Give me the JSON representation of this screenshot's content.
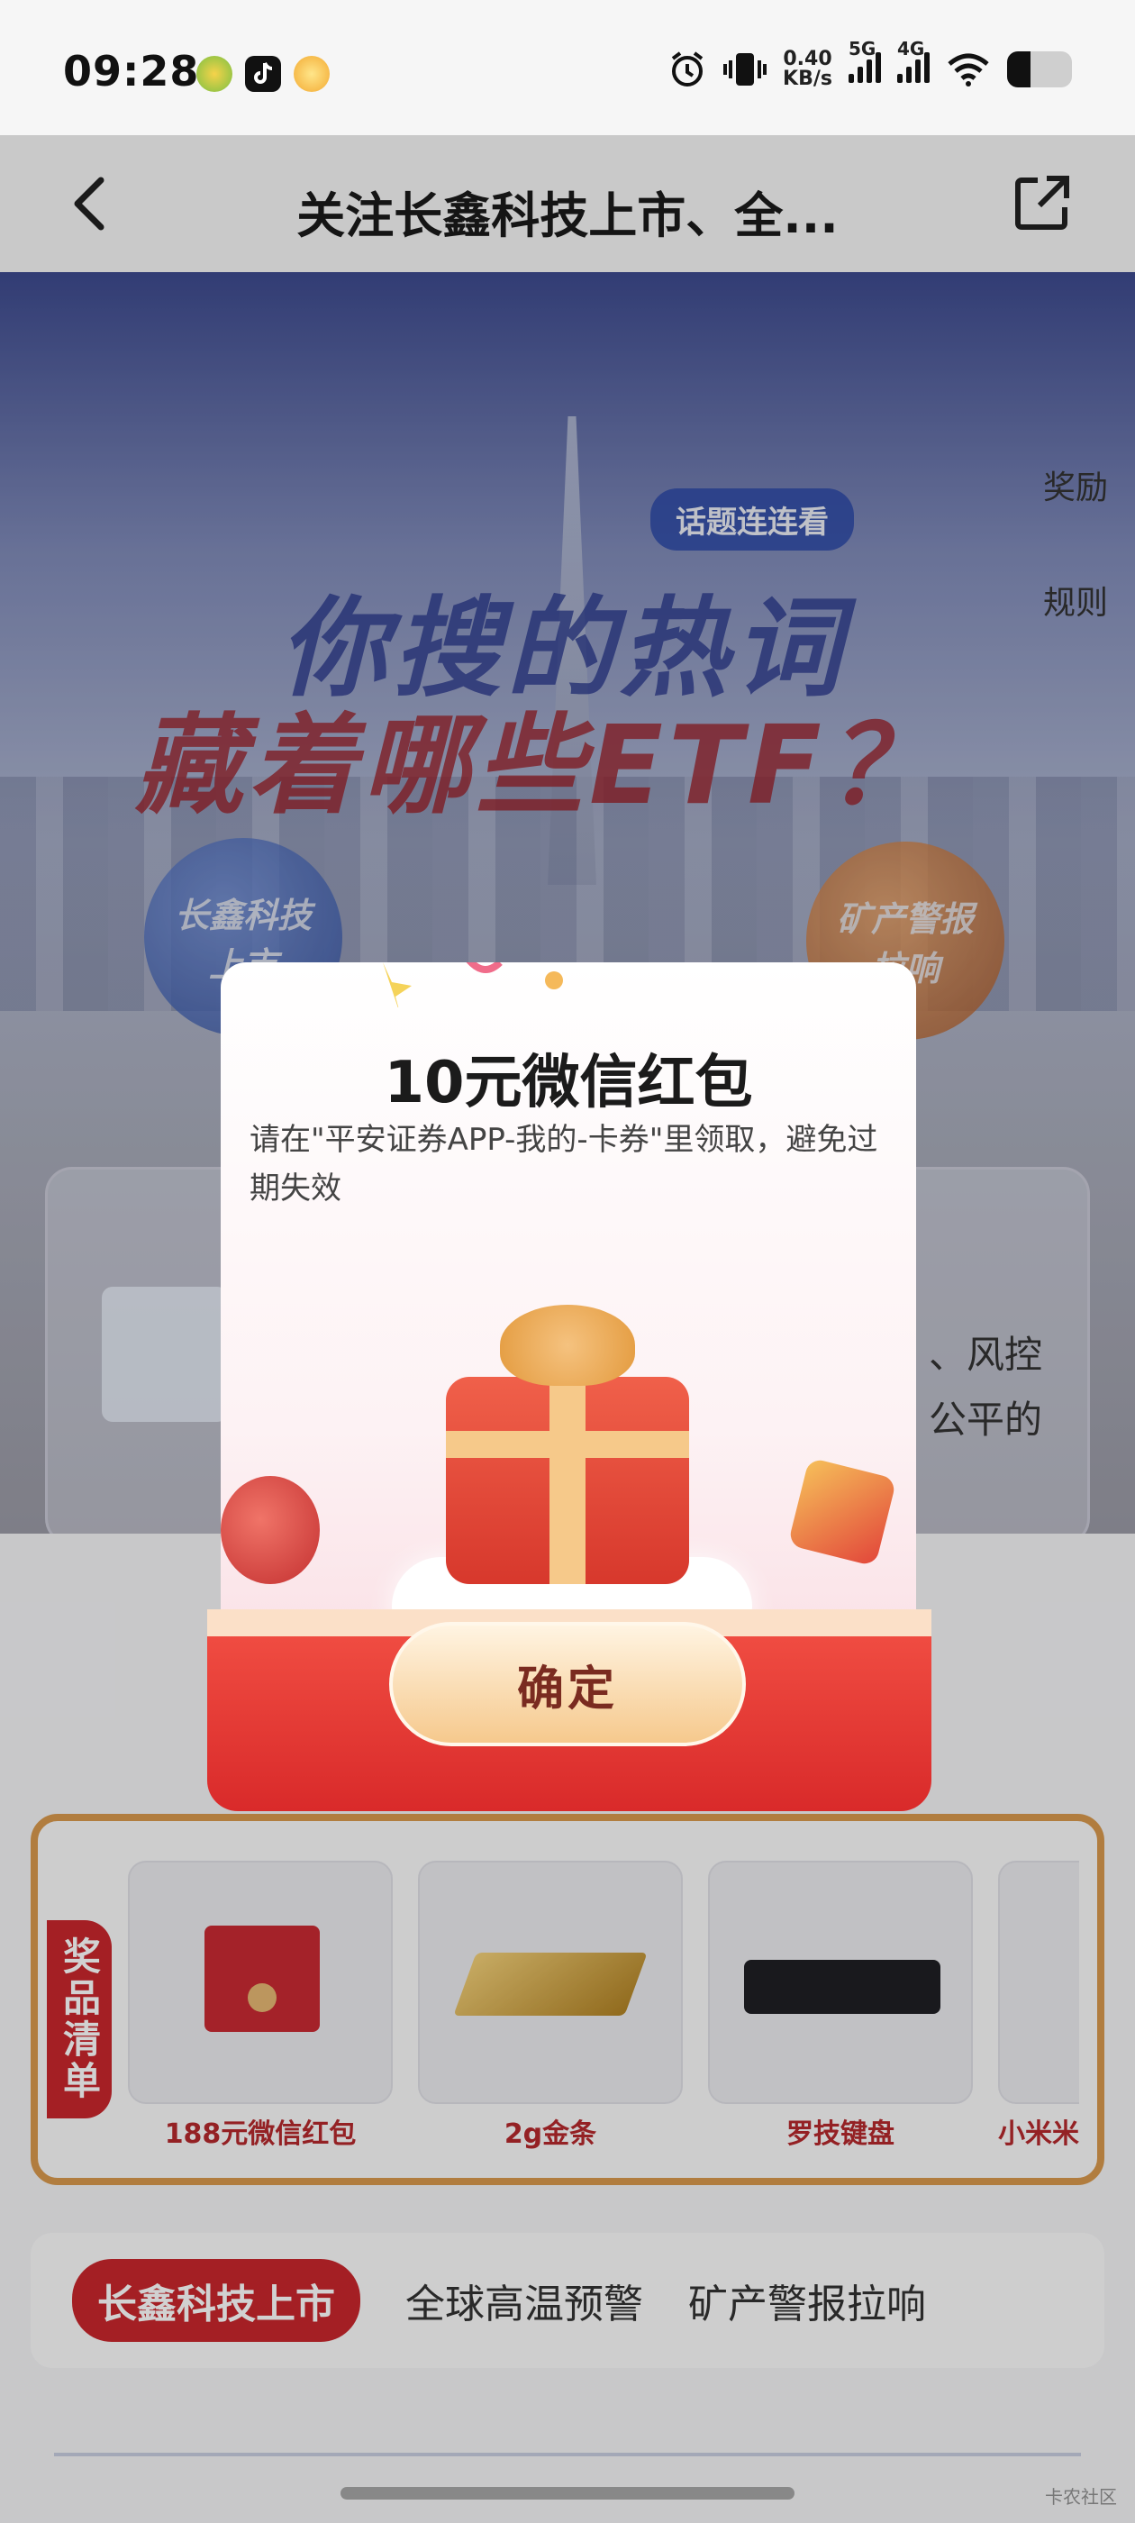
{
  "status_bar": {
    "time": "09:28",
    "net_speed_value": "0.40",
    "net_speed_unit": "KB/s",
    "sim1": "5G",
    "sim2": "4G"
  },
  "title_bar": {
    "title": "关注长鑫科技上市、全..."
  },
  "hero": {
    "topic_badge": "话题连连看",
    "headline_line1": "你搜的热词",
    "headline_line2": "藏着哪些ETF？",
    "side_links": [
      "奖励",
      "规则"
    ],
    "topic_ball_left": "长鑫科技上市",
    "topic_ball_right": "矿产警报拉响",
    "card_text": [
      "、风控",
      "公平的"
    ]
  },
  "dialog": {
    "title": "10元微信红包",
    "description": "请在\"平安证券APP-我的-卡券\"里领取，避免过期失效",
    "confirm_label": "确定"
  },
  "prizes": {
    "tag": "奖品清单",
    "items": [
      {
        "name": "188元微信红包"
      },
      {
        "name": "2g金条"
      },
      {
        "name": "罗技键盘"
      },
      {
        "name": "小米米"
      }
    ]
  },
  "tabs": {
    "items": [
      "长鑫科技上市",
      "全球高温预警",
      "矿产警报拉响"
    ],
    "active_index": 0
  },
  "watermark": "卡农社区",
  "colors": {
    "brand_red": "#c8272c",
    "gold_border": "#d8994e",
    "headline_blue": "#26358a"
  }
}
